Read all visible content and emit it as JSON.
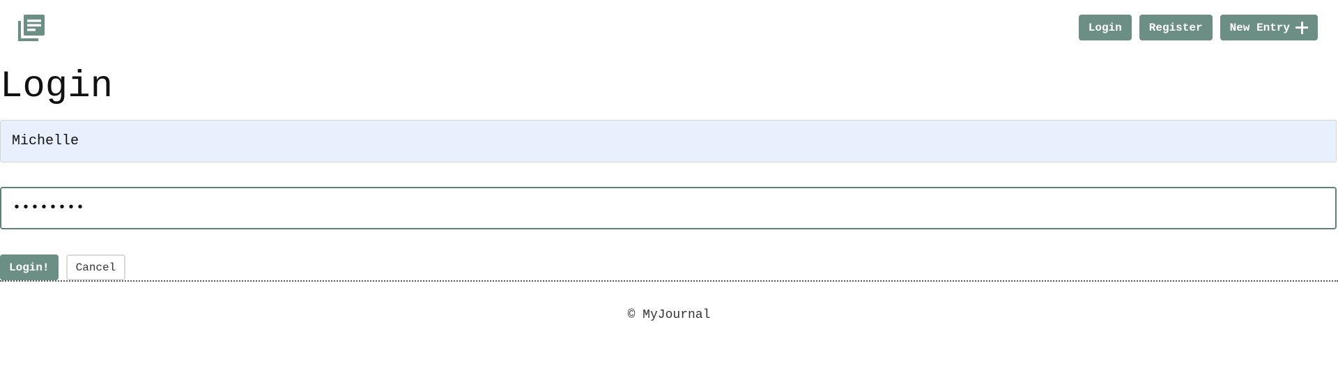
{
  "header": {
    "logo_icon": "journal-stack-icon",
    "nav": {
      "login_label": "Login",
      "register_label": "Register",
      "new_entry_label": "New Entry",
      "new_entry_icon": "plus-icon"
    }
  },
  "form": {
    "title": "Login",
    "username_value": "Michelle",
    "password_value": "••••••••",
    "submit_label": "Login!",
    "cancel_label": "Cancel"
  },
  "footer": {
    "text": "© MyJournal"
  },
  "colors": {
    "accent": "#6b8f84",
    "input_autofill_bg": "#e8f0fd",
    "focus_border": "#5e8176"
  }
}
